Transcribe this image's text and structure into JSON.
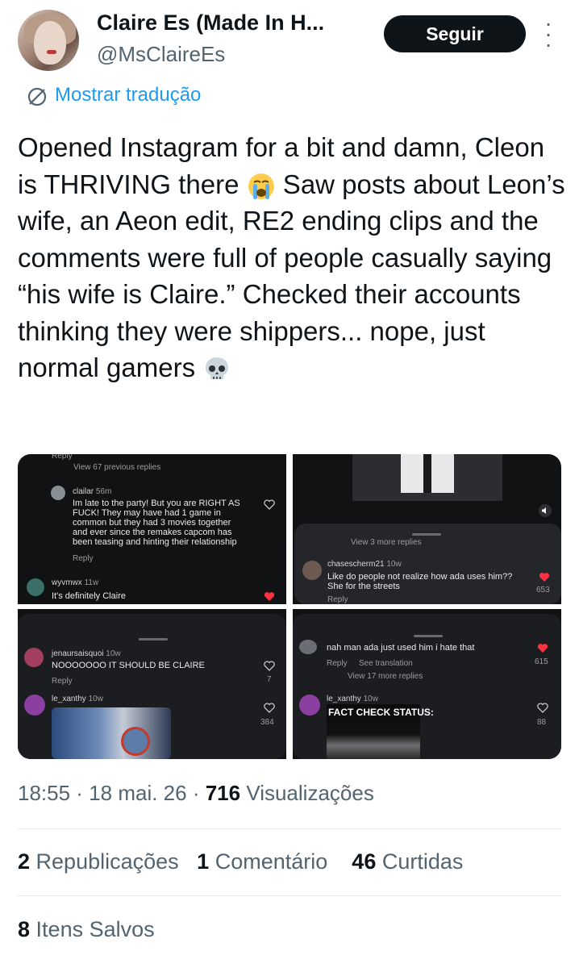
{
  "author": {
    "name": "Claire Es (Made In H...",
    "handle": "@MsClaireEs"
  },
  "follow_label": "Seguir",
  "translate_label": "Mostrar tradução",
  "tweet": {
    "part1": "Opened Instagram for a bit and damn, Cleon is THRIVING there ",
    "part2": " Saw posts about Leon’s wife, an Aeon edit, RE2 ending clips and the comments were full of people casually saying “his wife is Claire.” Checked their accounts thinking they were shippers... nope, just normal gamers ",
    "emoji1": "loudly-crying-face",
    "emoji2": "skull"
  },
  "screenshots": {
    "p1": {
      "reply_top": "Reply",
      "view_previous": "View 67 previous replies",
      "c1_user": "clailar",
      "c1_time": "56m",
      "c1_l1": "Im late to the party! But you are RIGHT AS",
      "c1_l2": "FUCK! They may have had 1 game in",
      "c1_l3": "common but they had 3 movies together",
      "c1_l4": "and ever since the remakes capcom has",
      "c1_l5": "been teasing and hinting their relationship",
      "c1_reply": "Reply",
      "c2_user": "wyvmwx",
      "c2_time": "11w",
      "c2_text": "It's definitely Claire"
    },
    "p2": {
      "view_more": "View 3 more replies",
      "c1_user": "chasescherm21",
      "c1_time": "10w",
      "c1_l1": "Like do people not realize how ada uses him??",
      "c1_l2": "She for the streets",
      "c1_likes": "653",
      "c1_reply": "Reply"
    },
    "p3": {
      "c1_user": "jenaursaisquoi",
      "c1_time": "10w",
      "c1_text": "NOOOOOOO IT SHOULD BE CLAIRE",
      "c1_reply": "Reply",
      "c1_likes": "7",
      "c2_user": "le_xanthy",
      "c2_time": "10w",
      "c2_likes": "384"
    },
    "p4": {
      "c1_text": "nah man ada just used him i hate that",
      "c1_reply": "Reply",
      "c1_see_translation": "See translation",
      "c1_likes": "615",
      "view_more": "View 17 more replies",
      "c2_user": "le_xanthy",
      "c2_time": "10w",
      "c2_image_text": "FACT CHECK STATUS:",
      "c2_likes": "88"
    }
  },
  "meta": {
    "time": "18:55",
    "date": "18 mai. 26",
    "views_count": "716",
    "views_label": "Visualizações"
  },
  "stats": {
    "reposts_count": "2",
    "reposts_label": "Republicações",
    "comments_count": "1",
    "comments_label": "Comentário",
    "likes_count": "46",
    "likes_label": "Curtidas",
    "saved_count": "8",
    "saved_label": "Itens Salvos"
  },
  "colors": {
    "accent": "#1d9bf0",
    "follow_bg": "#0f1419",
    "secondary_text": "#536471",
    "liked_heart": "#ff3040"
  }
}
